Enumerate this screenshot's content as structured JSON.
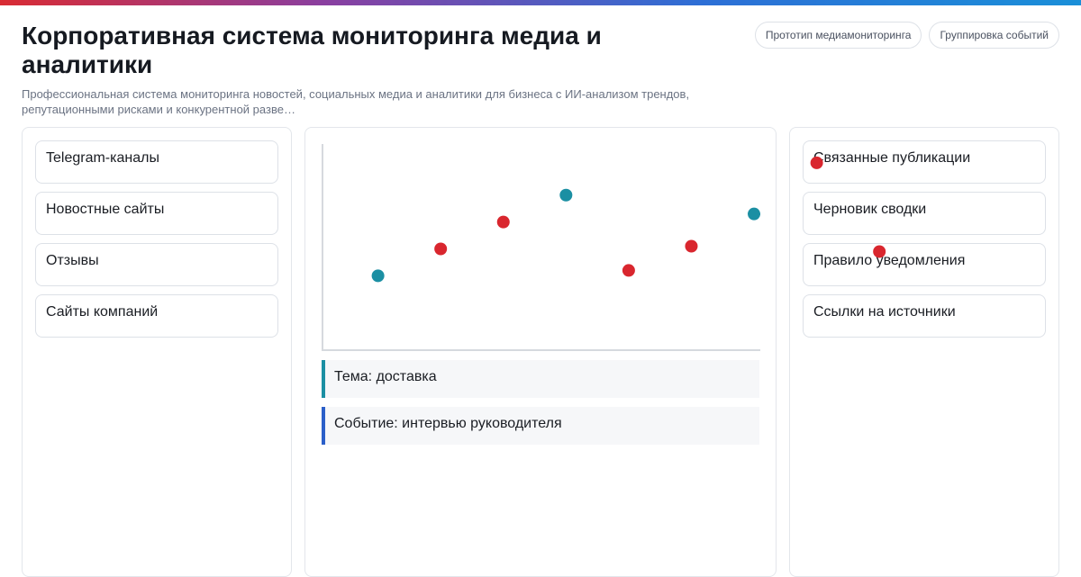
{
  "header": {
    "title": "Корпоративная система мониторинга медиа и аналитики",
    "subtitle": "Профессиональная система мониторинга новостей, социальных медиа и аналитики для бизнеса с ИИ-анализом трендов, репутационными рисками и конкурентной разве…",
    "pills": [
      "Прототип медиамониторинга",
      "Группировка событий"
    ]
  },
  "sources": [
    "Telegram-каналы",
    "Новостные сайты",
    "Отзывы",
    "Сайты компаний"
  ],
  "events": [
    {
      "label": "Тема: доставка",
      "color": "#1b8fa3"
    },
    {
      "label": "Событие: интервью руководителя",
      "color": "#2b5fc9"
    }
  ],
  "actions": [
    "Связанные публикации",
    "Черновик сводки",
    "Правило уведомления",
    "Ссылки на источники"
  ],
  "colors": {
    "teal": "#1b8fa3",
    "red": "#d9262e",
    "accent_bar": [
      "#d92b33",
      "#2d6fd6"
    ]
  },
  "chart_data": {
    "type": "scatter",
    "x": [
      1,
      2,
      3,
      4,
      5,
      6,
      7
    ],
    "series": [
      {
        "color": "#1b8fa3",
        "points": [
          [
            1,
            2.3
          ],
          [
            4,
            5.3
          ],
          [
            7,
            4.6
          ]
        ]
      },
      {
        "color": "#d9262e",
        "points": [
          [
            2,
            3.3
          ],
          [
            3,
            4.3
          ],
          [
            5,
            2.5
          ],
          [
            6,
            3.4
          ]
        ]
      }
    ],
    "xlim": [
      0.1,
      7.1
    ],
    "ylim": [
      -0.5,
      7.2
    ],
    "grid": false,
    "overflow_points": [
      {
        "color": "#d9262e",
        "x": 8.0,
        "y": 6.5
      },
      {
        "color": "#d9262e",
        "x": 9.0,
        "y": 3.2
      }
    ]
  }
}
